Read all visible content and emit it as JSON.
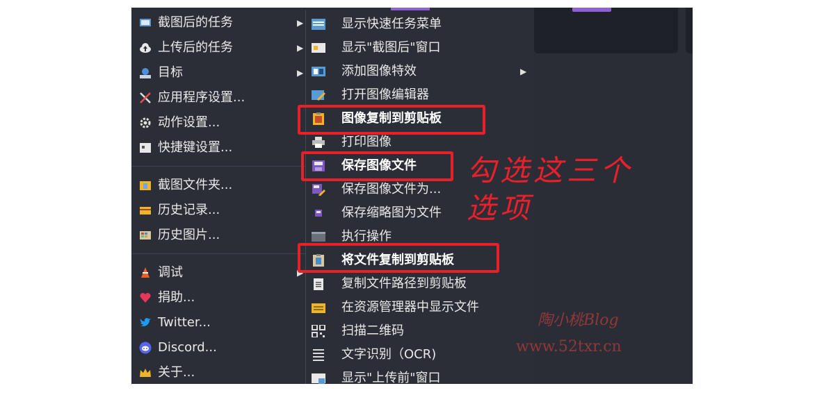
{
  "left_menu": {
    "items": [
      {
        "label": "截图后的任务",
        "icon": "task-after-capture-icon",
        "has_submenu": true
      },
      {
        "label": "上传后的任务",
        "icon": "cloud-upload-icon",
        "has_submenu": true
      },
      {
        "label": "目标",
        "icon": "destination-icon",
        "has_submenu": true
      },
      {
        "label": "应用程序设置...",
        "icon": "tools-icon",
        "has_submenu": false
      },
      {
        "label": "动作设置...",
        "icon": "gear-icon",
        "has_submenu": false
      },
      {
        "label": "快捷键设置...",
        "icon": "keyboard-icon",
        "has_submenu": false
      },
      {
        "label": "截图文件夹...",
        "icon": "folder-icon",
        "has_submenu": false
      },
      {
        "label": "历史记录...",
        "icon": "history-icon",
        "has_submenu": false
      },
      {
        "label": "历史图片...",
        "icon": "image-history-icon",
        "has_submenu": false
      },
      {
        "label": "调试",
        "icon": "debug-cone-icon",
        "has_submenu": true
      },
      {
        "label": "捐助...",
        "icon": "heart-icon",
        "has_submenu": false
      },
      {
        "label": "Twitter...",
        "icon": "twitter-icon",
        "has_submenu": false
      },
      {
        "label": "Discord...",
        "icon": "discord-icon",
        "has_submenu": false
      },
      {
        "label": "关于...",
        "icon": "crown-icon",
        "has_submenu": false
      }
    ]
  },
  "sub_menu": {
    "items": [
      {
        "label": "显示快速任务菜单",
        "checked": false
      },
      {
        "label": "显示\"截图后\"窗口",
        "checked": false
      },
      {
        "label": "添加图像特效",
        "checked": false,
        "has_submenu": true
      },
      {
        "label": "打开图像编辑器",
        "checked": false
      },
      {
        "label": "图像复制到剪贴板",
        "checked": true
      },
      {
        "label": "打印图像",
        "checked": false
      },
      {
        "label": "保存图像文件",
        "checked": true
      },
      {
        "label": "保存图像文件为...",
        "checked": false
      },
      {
        "label": "保存缩略图为文件",
        "checked": false
      },
      {
        "label": "执行操作",
        "checked": false
      },
      {
        "label": "将文件复制到剪贴板",
        "checked": true
      },
      {
        "label": "复制文件路径到剪贴板",
        "checked": false
      },
      {
        "label": "在资源管理器中显示文件",
        "checked": false
      },
      {
        "label": "扫描二维码",
        "checked": false
      },
      {
        "label": "文字识别（OCR)",
        "checked": false
      },
      {
        "label": "显示\"上传前\"窗口",
        "checked": false
      }
    ]
  },
  "annotation": {
    "line1": "勾选这三个",
    "line2": "选项"
  },
  "watermark": {
    "name": "陶小桃Blog",
    "url": "www.52txr.cn"
  },
  "colors": {
    "menu_bg": "#2b2e37",
    "text": "#e9e9ea",
    "highlight_box": "#e8202a",
    "pro_badge": "#8e5fd6"
  }
}
